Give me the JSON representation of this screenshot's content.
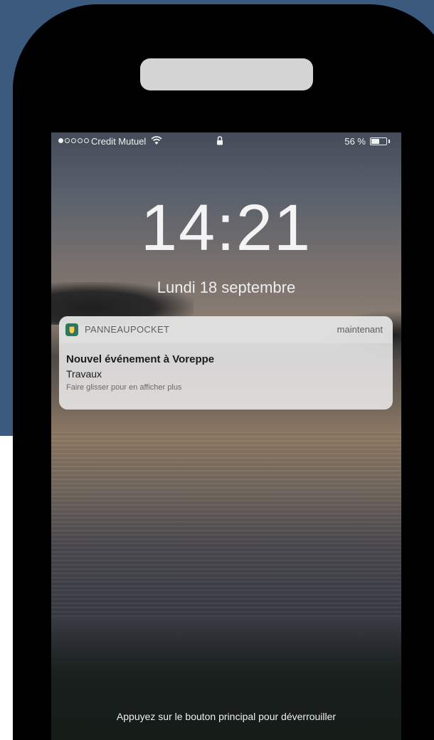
{
  "status_bar": {
    "carrier": "Credit Mutuel",
    "signal_bars_filled": 1,
    "signal_bars_total": 5,
    "battery_percent_label": "56 %",
    "battery_level": 0.56,
    "icons": [
      "wifi-icon",
      "lock-icon",
      "battery-icon"
    ]
  },
  "lock_screen": {
    "time": "14:21",
    "date": "Lundi 18 septembre",
    "unlock_hint": "Appuyez sur le bouton principal pour déverrouiller"
  },
  "notification": {
    "app_name": "PANNEAUPOCKET",
    "timestamp": "maintenant",
    "title": "Nouvel événement à Voreppe",
    "body": "Travaux",
    "hint": "Faire glisser pour en afficher plus"
  },
  "colors": {
    "page_background": "#3c5a7e",
    "phone_frame": "#000000",
    "speaker": "#d4d4d4",
    "app_icon": "#2e7a5a"
  }
}
